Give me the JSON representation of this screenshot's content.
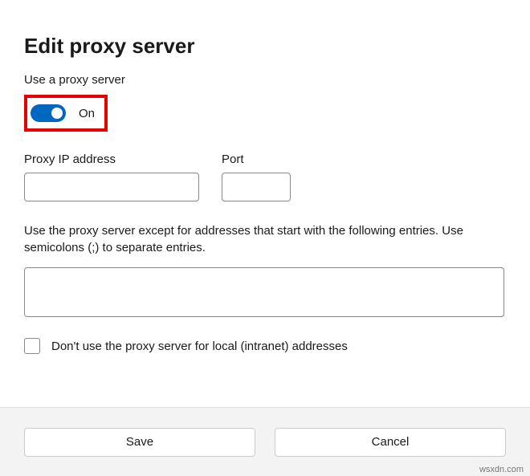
{
  "title": "Edit proxy server",
  "toggle": {
    "section_label": "Use a proxy server",
    "state_label": "On"
  },
  "fields": {
    "ip_label": "Proxy IP address",
    "ip_value": "",
    "port_label": "Port",
    "port_value": ""
  },
  "exceptions": {
    "description": "Use the proxy server except for addresses that start with the following entries. Use semicolons (;) to separate entries.",
    "value": ""
  },
  "local": {
    "checkbox_label": "Don't use the proxy server for local (intranet) addresses"
  },
  "buttons": {
    "save": "Save",
    "cancel": "Cancel"
  },
  "watermark": "wsxdn.com"
}
